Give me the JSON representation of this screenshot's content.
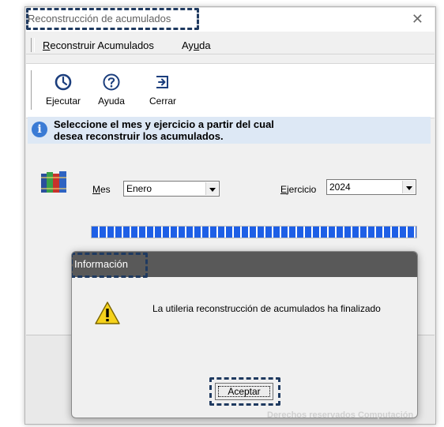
{
  "window": {
    "title": "Reconstrucción de acumulados",
    "close_symbol": "✕"
  },
  "menu": {
    "items": [
      {
        "label": "Reconstruir Acumulados",
        "accel": "R"
      },
      {
        "label": "Ayuda",
        "accel": "u"
      }
    ]
  },
  "toolbar": {
    "buttons": [
      {
        "label": "Ejecutar",
        "icon": "clock-icon"
      },
      {
        "label": "Ayuda",
        "icon": "help-icon"
      },
      {
        "label": "Cerrar",
        "icon": "exit-icon"
      }
    ]
  },
  "info": {
    "line1": "Seleccione el mes y ejercicio a partir del cual",
    "line2": "desea reconstruir  los acumulados."
  },
  "form": {
    "mes_label": "Mes",
    "mes_value": "Enero",
    "ejercicio_label": "Ejercicio",
    "ejercicio_value": "2024"
  },
  "progress": {
    "percent": 100,
    "color": "#1e5fe6"
  },
  "dialog": {
    "title": "Información",
    "message": "La utileria reconstrucción de acumulados ha finalizado",
    "ok_label": "Aceptar",
    "icon": "warning-icon"
  },
  "watermark": {
    "text": "Derechos reservados Computación"
  },
  "colors": {
    "accent_dash": "#1f3a60",
    "dialog_title_bg": "#595959",
    "info_banner_bg": "#dde8f5"
  }
}
